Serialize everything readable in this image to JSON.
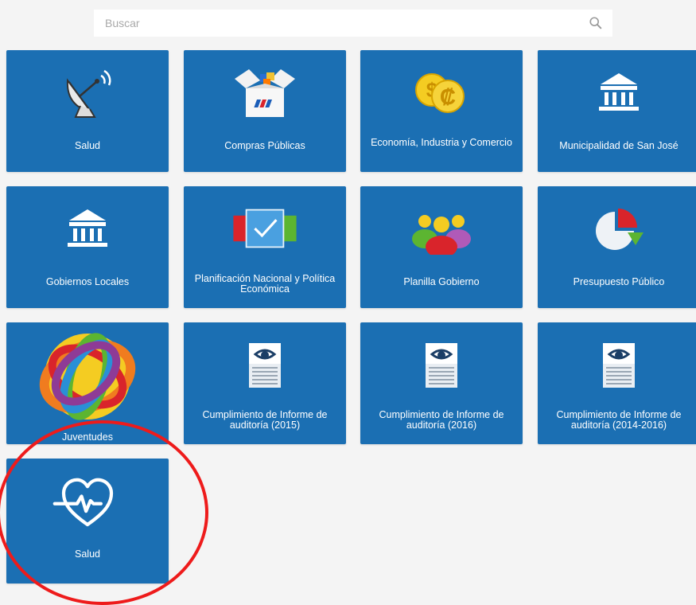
{
  "search": {
    "placeholder": "Buscar"
  },
  "tiles": [
    {
      "label": "Salud",
      "icon": "satellite-dish-icon"
    },
    {
      "label": "Compras Públicas",
      "icon": "open-box-icon"
    },
    {
      "label": "Economía, Industria y Comercio",
      "icon": "coins-icon"
    },
    {
      "label": "Municipalidad de San José",
      "icon": "government-building-icon"
    },
    {
      "label": "Gobiernos Locales",
      "icon": "government-building-icon"
    },
    {
      "label": "Planificación Nacional y Política Económica",
      "icon": "checkbox-panels-icon"
    },
    {
      "label": "Planilla Gobierno",
      "icon": "people-group-icon"
    },
    {
      "label": "Presupuesto Público",
      "icon": "pie-chart-icon"
    },
    {
      "label": "Juventudes",
      "icon": "juventudes-logo-icon"
    },
    {
      "label": "Cumplimiento de Informe de auditoría (2015)",
      "icon": "audit-report-icon"
    },
    {
      "label": "Cumplimiento de Informe de auditoría (2016)",
      "icon": "audit-report-icon"
    },
    {
      "label": "Cumplimiento de Informe de auditoría (2014-2016)",
      "icon": "audit-report-icon"
    },
    {
      "label": "Salud",
      "icon": "heart-pulse-icon"
    }
  ],
  "colors": {
    "tile_bg": "#1b6fb3",
    "page_bg": "#f4f4f4",
    "highlight_ring": "#ee1b1b"
  }
}
